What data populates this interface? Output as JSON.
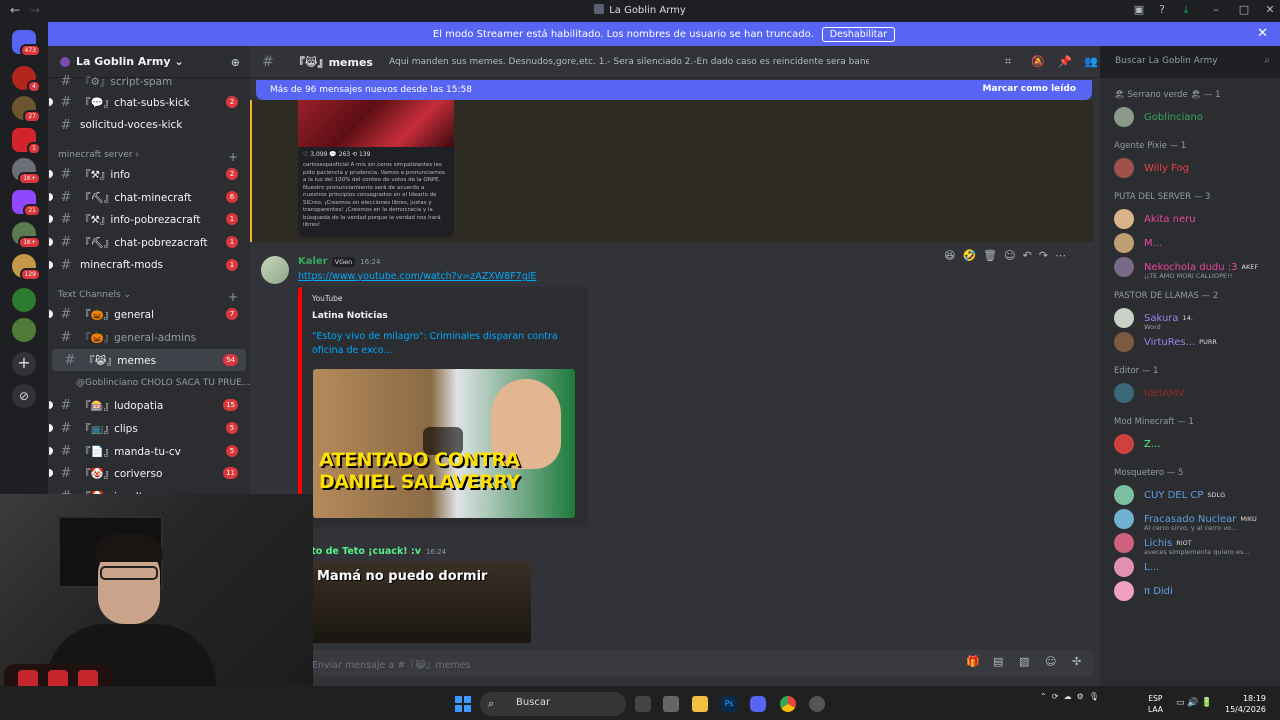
{
  "window": {
    "title": "La Goblin Army"
  },
  "banner": {
    "text": "El modo Streamer está habilitado. Los nombres de usuario se han truncado.",
    "button": "Deshabilitar"
  },
  "server_list": {
    "badges": [
      "473",
      "4",
      "27",
      "1",
      "1K+",
      "21",
      "1K+",
      "129"
    ]
  },
  "server": {
    "name": "La Goblin Army"
  },
  "channels": {
    "items": [
      {
        "name": "『⚙』script-spam"
      },
      {
        "name": "『💬』chat-subs-kick",
        "count": "2"
      },
      {
        "name": "solicitud-voces-kick"
      }
    ],
    "cat_minecraft": "minecraft server",
    "minecraft": [
      {
        "name": "『⚒』info",
        "count": "2"
      },
      {
        "name": "『⛏』chat-minecraft",
        "count": "6"
      },
      {
        "name": "『⚒』info-pobrezacraft",
        "count": "1"
      },
      {
        "name": "『⛏』chat-pobrezacraft",
        "count": "1"
      },
      {
        "name": "minecraft-mods",
        "count": "1"
      }
    ],
    "cat_text": "Text Channels",
    "text": [
      {
        "name": "『🎃』general",
        "count": "7"
      },
      {
        "name": "『🎃』general-admins"
      },
      {
        "name": "『😹』memes",
        "count": "54"
      },
      {
        "name": "@Goblinciano CHOLO SACA TU PRUE..."
      },
      {
        "name": "『🎰』ludopatia",
        "count": "15"
      },
      {
        "name": "『📺』clips",
        "count": "5"
      },
      {
        "name": "『📄』manda-tu-cv",
        "count": "5"
      },
      {
        "name": "『🤡』coriverso",
        "count": "11"
      },
      {
        "name": "『🤡』insulto..."
      }
    ]
  },
  "header": {
    "channel": "『😹』memes",
    "topic": "Aqui manden sus memes. Desnudos,gore,etc. 1.- Sera silenciado 2.-En dado caso es reincidente sera baneado",
    "search_placeholder": "Buscar La Goblin Army"
  },
  "new_messages": {
    "text": "Más de 96 mensajes nuevos desde las 15:58",
    "mark_read": "Marcar como leído"
  },
  "ig_post": {
    "stats": "♡ 3,099   💬 263   ⟲ 139",
    "caption": "carlosespaoficial A mis sin.ceros simpatizantes les pido paciencia y prudencia. Vamos a pronunciarnos a la luz del 100% del conteo de votos de la ONPE. Nuestro pronunciamiento será de acuerdo a nuestros principios consagrados en el Ideario de SICreo. ¡Creemos en elecciones libres, justas y transparentes! ¡Creemos en la democracia y la búsqueda de la verdad porque la verdad nos hará libres!"
  },
  "message1": {
    "author": "Kaler",
    "tag": "VGen",
    "time": "16:24",
    "link": "https://www.youtube.com/watch?v=zAZXW8F7glE",
    "embed": {
      "provider": "YouTube",
      "author": "Latina Noticias",
      "title": "\"Estoy vivo de milagro\": Criminales disparan contra oficina de exco...",
      "thumb_text": "ATENTADO CONTRA DANIEL SALAVERRY"
    }
  },
  "message2": {
    "author": "pato de Teto ¡cuack! :v",
    "time": "16:24",
    "gif_caption": "Mamá no puedo dormir"
  },
  "composer": {
    "placeholder": "Enviar mensaje a #『😹』memes"
  },
  "members": {
    "groups": [
      {
        "label": "🏖 Serrano verde 🏖 — 1",
        "members": [
          {
            "name": "Goblinciano",
            "color": "#3ba55c"
          }
        ]
      },
      {
        "label": "Agente Pixie — 1",
        "members": [
          {
            "name": "Willy Fog",
            "color": "#ed4245"
          }
        ]
      },
      {
        "label": "PUTA DEL SERVER — 3",
        "members": [
          {
            "name": "Akita neru",
            "color": "#eb459e"
          },
          {
            "name": "M...",
            "color": "#eb459e"
          },
          {
            "name": "Nekochola dudu :3",
            "color": "#eb459e",
            "tag": "AKEF",
            "sub": "¡¡TE AMO MORI CALLIOPE!!"
          }
        ]
      },
      {
        "label": "PASTOR DE LLAMAS — 2",
        "members": [
          {
            "name": "Sakura",
            "color": "#9b84ec",
            "tag": "14.",
            "sub": "Word"
          },
          {
            "name": "VirtuRes...",
            "color": "#9b84ec",
            "tag": "PURR"
          }
        ]
      },
      {
        "label": "Editor — 1",
        "members": [
          {
            "name": "IdelAMV",
            "color": "#992d22"
          }
        ]
      },
      {
        "label": "Mod Minecraft — 1",
        "members": [
          {
            "name": "Z...",
            "color": "#57f287"
          }
        ]
      },
      {
        "label": "Mosquetero — 5",
        "members": [
          {
            "name": "CUY DEL CP",
            "color": "#5f9ee0",
            "tag": "SDLG"
          },
          {
            "name": "Fracasado Nuclear",
            "color": "#5f9ee0",
            "tag": "MIKU",
            "sub": "Al cerro sirvo, y al cerro vo..."
          },
          {
            "name": "Lichis",
            "color": "#5f9ee0",
            "tag": "RIOT",
            "sub": "aveces simplemente quiero es..."
          },
          {
            "name": "L...",
            "color": "#5f9ee0"
          },
          {
            "name": "π Didi",
            "color": "#5f9ee0"
          }
        ]
      }
    ]
  },
  "taskbar": {
    "search": "Buscar",
    "lang1": "ESP",
    "lang2": "LAA",
    "time": "18:19",
    "date": "15/4/2026"
  }
}
